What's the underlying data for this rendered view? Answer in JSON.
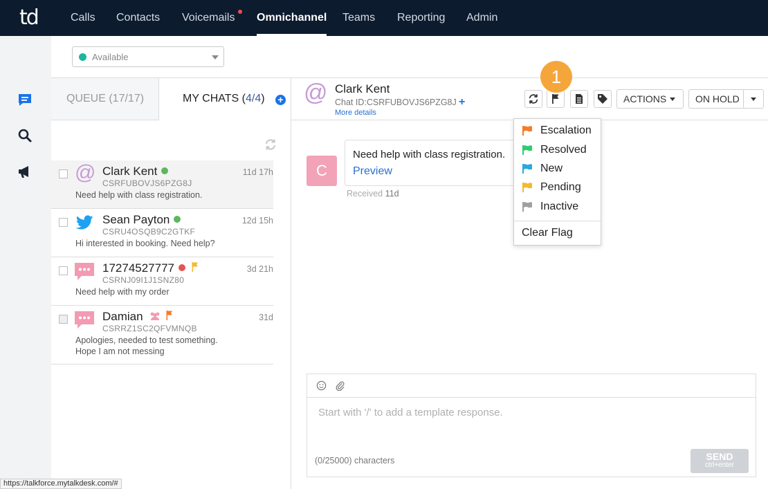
{
  "app": {
    "logo": "td"
  },
  "nav": {
    "items": [
      {
        "label": "Calls"
      },
      {
        "label": "Contacts"
      },
      {
        "label": "Voicemails"
      },
      {
        "label": "Omnichannel"
      },
      {
        "label": "Teams"
      },
      {
        "label": "Reporting"
      },
      {
        "label": "Admin"
      }
    ],
    "active": "Omnichannel"
  },
  "status": {
    "value": "Available",
    "color": "#19b89b"
  },
  "tabs": {
    "queue": "QUEUE (17/17)",
    "my_chats_label": "MY CHATS (",
    "my_chats_count": "4/4",
    "my_chats_close": ")"
  },
  "chats": [
    {
      "name": "Clark Kent",
      "id": "CSRFUBOVJS6PZG8J",
      "message": "Need help with class registration.",
      "time": "11d 17h",
      "channel": "email",
      "status": "online"
    },
    {
      "name": "Sean Payton",
      "id": "CSRU4OSQB9C2GTKF",
      "message": "Hi interested in booking. Need help?",
      "time": "12d 15h",
      "channel": "twitter",
      "status": "online"
    },
    {
      "name": "17274527777",
      "id": "CSRNJ09I1J1SNZ80",
      "message": "Need help with my order",
      "time": "3d 21h",
      "channel": "sms",
      "status": "offline",
      "flag": "pending"
    },
    {
      "name": "Damian",
      "id": "CSRRZ1SC2QFVMNQB",
      "message": "Apologies, needed to test something. Hope I am not messing",
      "time": "31d",
      "channel": "sms",
      "status": "group",
      "flag": "escalation"
    }
  ],
  "conversation": {
    "name": "Clark Kent",
    "chat_id": "Chat ID:CSRFUBOVJS6PZG8J",
    "more_details": "More details",
    "actions_label": "ACTIONS",
    "hold_label": "ON HOLD",
    "step_badge": "1",
    "message": {
      "avatar_letter": "C",
      "text": "Need help with class registration.",
      "link": "Preview",
      "received_label": "Received",
      "received_value": "11d"
    }
  },
  "flag_menu": {
    "items": [
      {
        "label": "Escalation",
        "color": "#f57c2a"
      },
      {
        "label": "Resolved",
        "color": "#2ecc71"
      },
      {
        "label": "New",
        "color": "#2aa8e0"
      },
      {
        "label": "Pending",
        "color": "#f5b82e"
      },
      {
        "label": "Inactive",
        "color": "#a0a0a0"
      }
    ],
    "clear": "Clear Flag"
  },
  "composer": {
    "placeholder": "Start with '/' to add a template response.",
    "count": "(0/25000) characters",
    "send": "SEND",
    "send_hint": "ctrl+enter"
  },
  "status_url": "https://talkforce.mytalkdesk.com/#"
}
